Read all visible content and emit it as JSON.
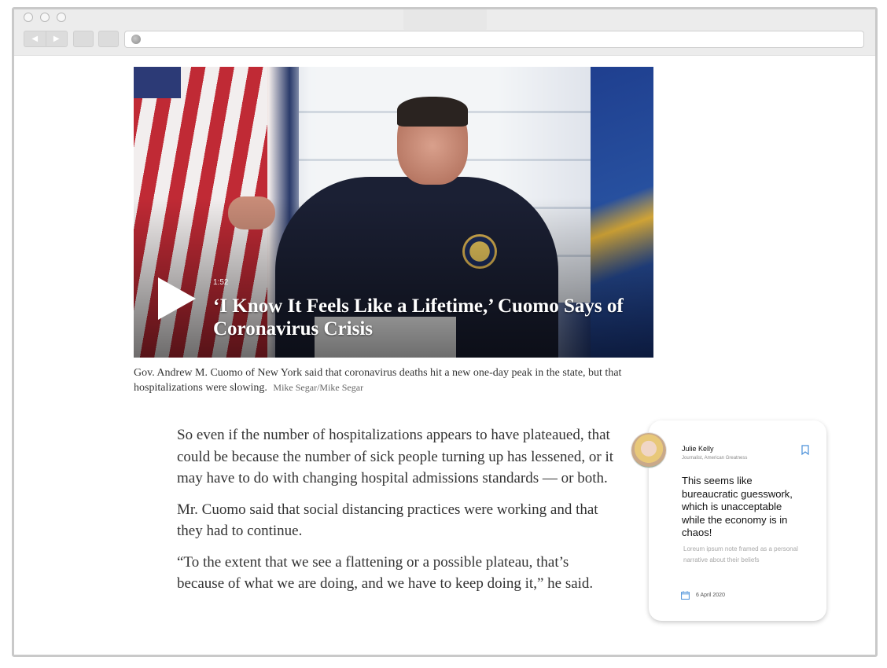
{
  "browser": {
    "nav_back": "◀",
    "nav_forward": "▶",
    "address_value": ""
  },
  "video": {
    "duration": "1:52",
    "title": "‘I Know It Feels Like a Lifetime,’ Cuomo Says of Coronavirus Crisis"
  },
  "caption": {
    "text": "Gov. Andrew M. Cuomo of New York said that coronavirus deaths hit a new one-day peak in the state, but that hospitalizations were slowing.",
    "credit": "Mike Segar/Mike Segar"
  },
  "article": {
    "paragraphs": [
      "So even if the number of hospitalizations appears to have plateaued, that could be because the number of sick people turning up has lessened, or it may have to do with changing hospital admissions standards — or both.",
      "Mr. Cuomo said that social distancing practices were working and that they had to continue.",
      "“To the extent that we see a flattening or a possible plateau, that’s because of what we are doing, and we have to keep doing it,” he said."
    ]
  },
  "comment_card": {
    "author": "Julie Kelly",
    "role": "Journalist, American Greatness",
    "comment": "This seems like bureaucratic guesswork, which is unacceptable while the economy is in chaos!",
    "note": "Loreum ipsum note framed as a personal narrative about their beliefs",
    "date": "6 April 2020",
    "accent_color": "#4a90d9"
  }
}
